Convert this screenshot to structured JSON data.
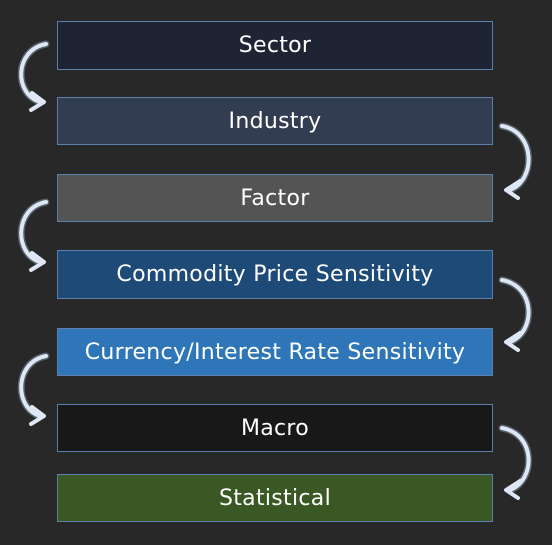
{
  "levels": [
    {
      "label": "Sector",
      "color": "#1f2434"
    },
    {
      "label": "Industry",
      "color": "#333d51"
    },
    {
      "label": "Factor",
      "color": "#545454"
    },
    {
      "label": "Commodity Price Sensitivity",
      "color": "#1e4a78"
    },
    {
      "label": "Currency/Interest Rate Sensitivity",
      "color": "#2e76b8"
    },
    {
      "label": "Macro",
      "color": "#181818"
    },
    {
      "label": "Statistical",
      "color": "#395824"
    }
  ],
  "arrow_color": "#dde8f4",
  "background": "#282828"
}
